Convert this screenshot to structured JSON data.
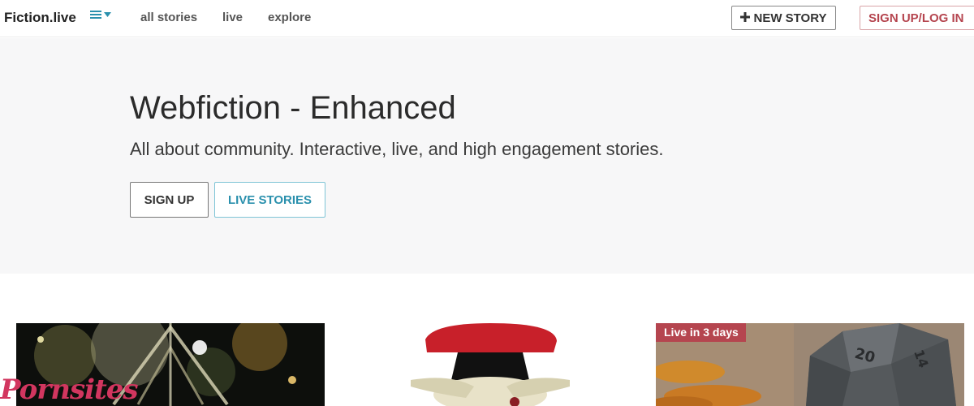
{
  "navbar": {
    "brand": "Fiction.live",
    "links": [
      "all stories",
      "live",
      "explore"
    ],
    "new_story_label": "NEW STORY",
    "signup_login_label": "SIGN UP/LOG IN"
  },
  "hero": {
    "title": "Webfiction - Enhanced",
    "subtitle": "All about community. Interactive, live, and high engagement stories.",
    "signup_label": "SIGN UP",
    "live_stories_label": "LIVE STORIES"
  },
  "cards": [
    {
      "badge": ""
    },
    {
      "badge": ""
    },
    {
      "badge": "Live in 3 days"
    }
  ],
  "watermark": "Pornsites",
  "colors": {
    "accent_red": "#b5454f",
    "accent_blue": "#2a90ad",
    "hero_bg": "#f7f7f8"
  }
}
